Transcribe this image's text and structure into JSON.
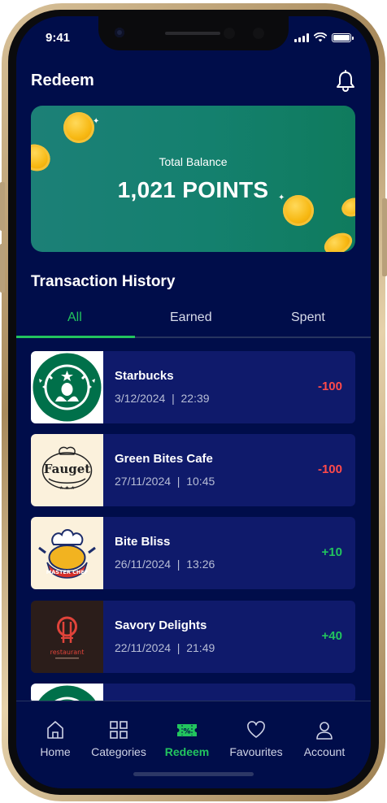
{
  "status_bar": {
    "time": "9:41"
  },
  "header": {
    "title": "Redeem",
    "bell_icon": "bell-icon"
  },
  "balance": {
    "label": "Total Balance",
    "value": "1,021 POINTS"
  },
  "history": {
    "title": "Transaction History",
    "tabs": [
      {
        "label": "All",
        "active": true
      },
      {
        "label": "Earned",
        "active": false
      },
      {
        "label": "Spent",
        "active": false
      }
    ],
    "transactions": [
      {
        "name": "Starbucks",
        "date": "3/12/2024",
        "time": "22:39",
        "amount": "-100",
        "logo": "starbucks-logo"
      },
      {
        "name": "Green Bites Cafe",
        "date": "27/11/2024",
        "time": "10:45",
        "amount": "-100",
        "logo": "fauget-logo",
        "logo_text": "Fauget"
      },
      {
        "name": "Bite Bliss",
        "date": "26/11/2024",
        "time": "13:26",
        "amount": "+10",
        "logo": "master-chef-logo",
        "logo_text": "MASTER CHEF"
      },
      {
        "name": "Savory Delights",
        "date": "22/11/2024",
        "time": "21:49",
        "amount": "+40",
        "logo": "restaurant-logo",
        "logo_text": "restaurant"
      }
    ]
  },
  "nav": {
    "items": [
      {
        "label": "Home",
        "icon": "home-icon",
        "active": false
      },
      {
        "label": "Categories",
        "icon": "grid-icon",
        "active": false
      },
      {
        "label": "Redeem",
        "icon": "ticket-icon",
        "active": true
      },
      {
        "label": "Favourites",
        "icon": "heart-icon",
        "active": false
      },
      {
        "label": "Account",
        "icon": "user-icon",
        "active": false
      }
    ]
  },
  "colors": {
    "background": "#000d4a",
    "card": "#0f1a6b",
    "accent_green": "#22c45e",
    "negative_red": "#ff4a4a",
    "balance_gradient_start": "#1c8077",
    "balance_gradient_end": "#0f7b5d"
  }
}
